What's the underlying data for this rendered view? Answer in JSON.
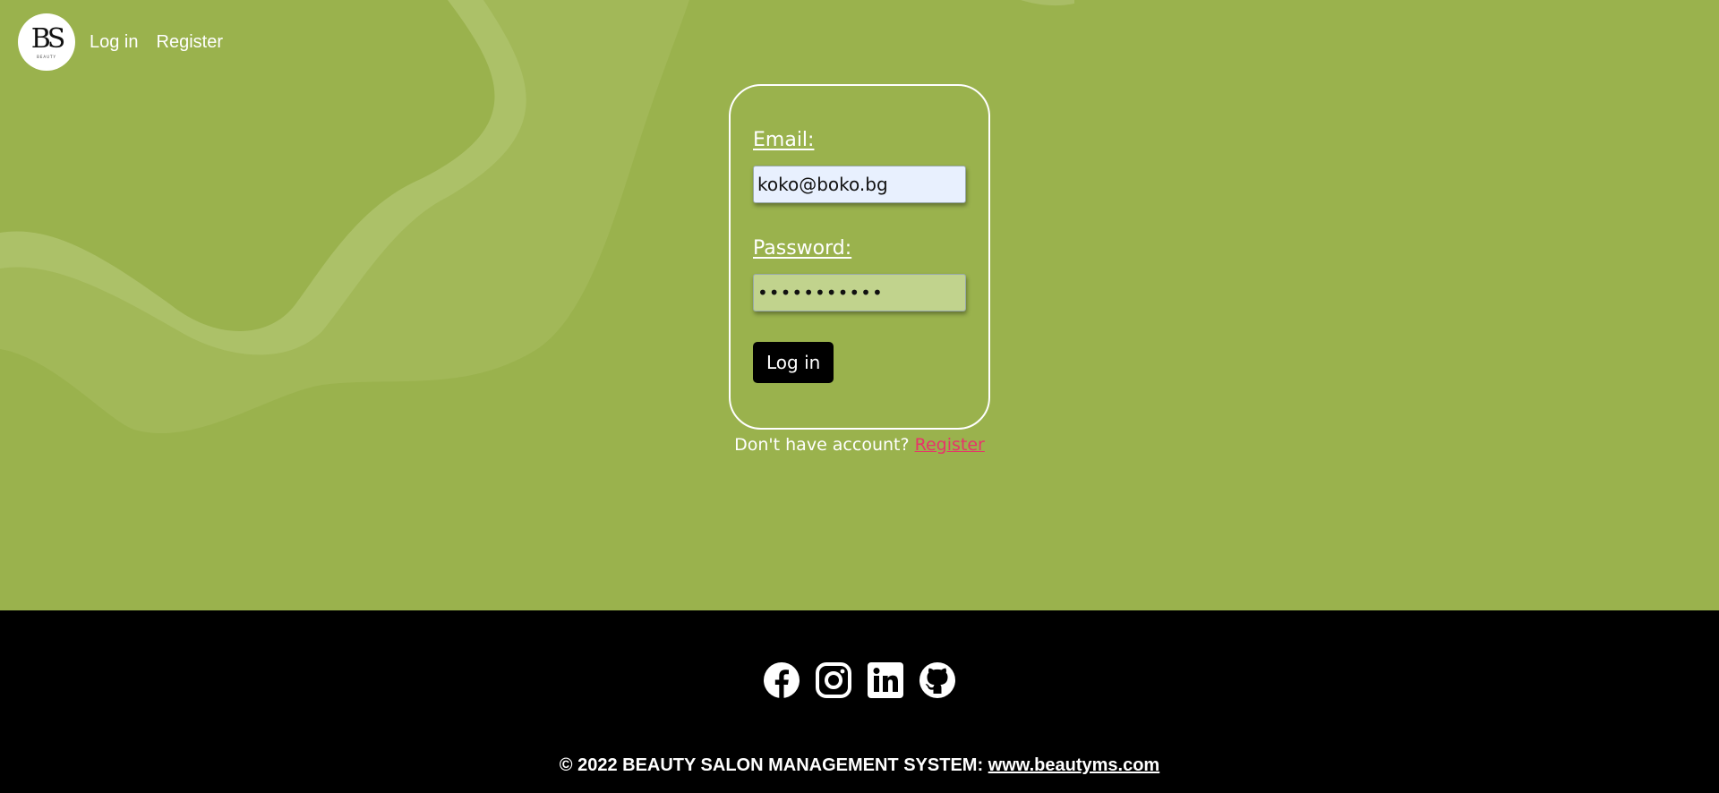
{
  "nav": {
    "logo_text": "BS",
    "logo_subtext": "BEAUTY",
    "login_label": "Log in",
    "register_label": "Register"
  },
  "form": {
    "email_label": "Email:",
    "email_value": "koko@boko.bg",
    "password_label": "Password:",
    "password_value": "•••••••••••",
    "submit_label": "Log in"
  },
  "register_prompt": {
    "text": "Don't have account?",
    "link_label": "Register"
  },
  "footer": {
    "social_icons": [
      "facebook-icon",
      "instagram-icon",
      "linkedin-icon",
      "github-icon"
    ],
    "copyright_text": "© 2022 BEAUTY SALON MANAGEMENT SYSTEM:",
    "site_link": "www.beautyms.com"
  },
  "colors": {
    "background": "#9ab24d",
    "register_link": "#e8336a",
    "footer": "#000000",
    "password_autofill": "#c1d38d",
    "email_autofill": "#e8f0fe"
  }
}
